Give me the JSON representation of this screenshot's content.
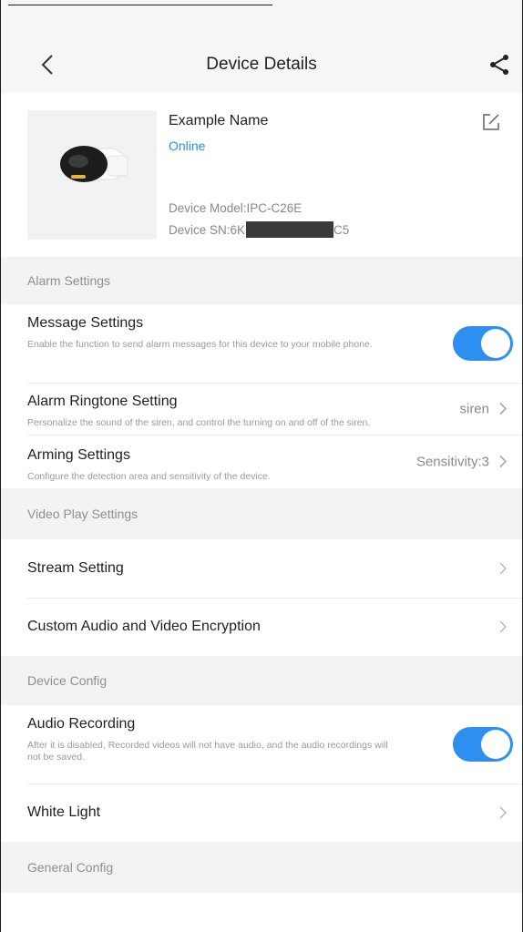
{
  "header": {
    "title": "Device Details",
    "back_icon": "chevron-left-icon",
    "share_icon": "share-icon"
  },
  "device": {
    "name": "Example Name",
    "status": "Online",
    "model": "Device Model:IPC-C26E",
    "sn_prefix": "Device SN:6K",
    "sn_suffix": "C5"
  },
  "sections": {
    "alarm": {
      "title": "Alarm Settings",
      "message": {
        "title": "Message Settings",
        "desc": "Enable the function to send alarm messages for this device to your mobile phone.",
        "enabled": true
      },
      "ringtone": {
        "title": "Alarm Ringtone Setting",
        "desc": "Personalize the sound of the siren, and control the turning on and off of the siren.",
        "value": "siren"
      },
      "arming": {
        "title": "Arming Settings",
        "desc": "Configure the detection area and sensitivity of the device.",
        "value": "Sensitivity:3"
      }
    },
    "video": {
      "title": "Video Play Settings",
      "stream": {
        "title": "Stream Setting"
      },
      "encryption": {
        "title": "Custom Audio and Video Encryption"
      }
    },
    "config": {
      "title": "Device Config",
      "audio": {
        "title": "Audio Recording",
        "desc": "After it is disabled, Recorded videos will not have audio, and the audio recordings will not be saved.",
        "enabled": true
      },
      "white_light": {
        "title": "White Light"
      }
    },
    "general": {
      "title": "General Config"
    }
  },
  "colors": {
    "accent": "#2d8ff0",
    "status_online": "#2c8de0",
    "section_bg": "#f3f3f3"
  }
}
